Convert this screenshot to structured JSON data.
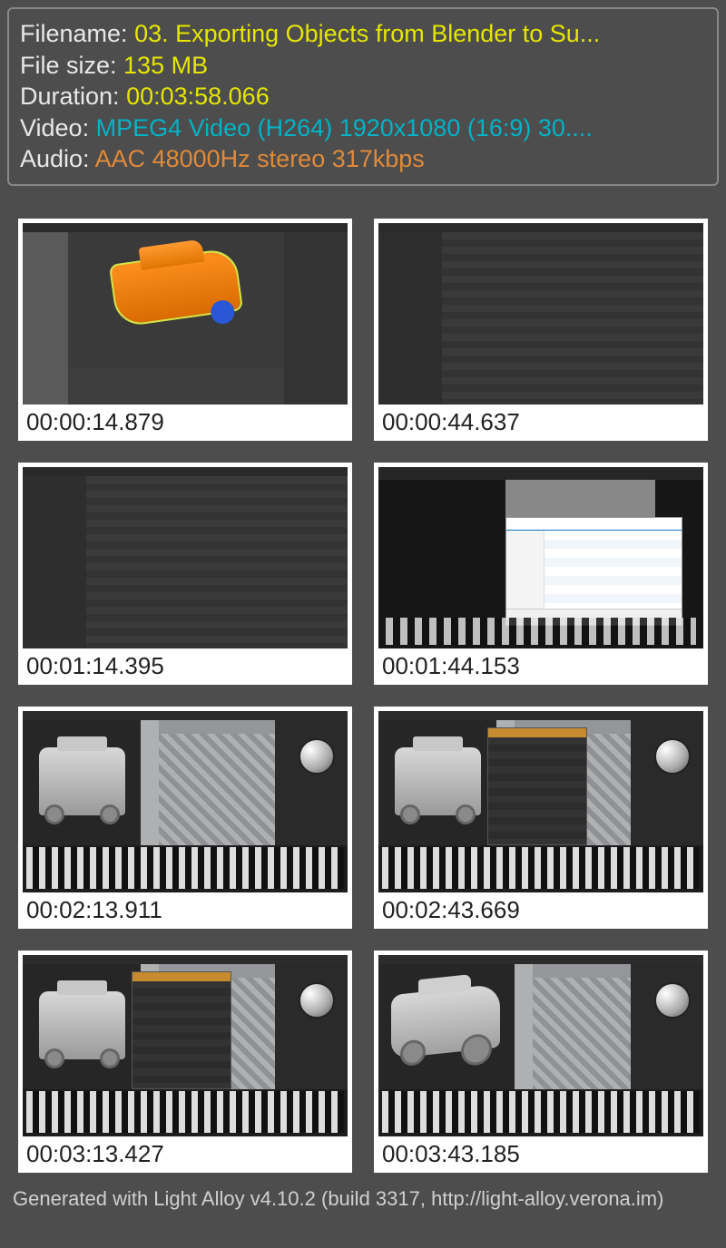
{
  "info": {
    "filename_label": "Filename: ",
    "filename_value": "03. Exporting Objects from Blender to Su...",
    "filesize_label": "File size: ",
    "filesize_value": "135 MB",
    "duration_label": "Duration: ",
    "duration_value": "00:03:58.066",
    "video_label": "Video: ",
    "video_value": "MPEG4 Video (H264) 1920x1080 (16:9) 30....",
    "audio_label": "Audio: ",
    "audio_value": "AAC 48000Hz stereo 317kbps"
  },
  "thumbnails": [
    {
      "ts": "00:00:14.879",
      "type": "blender-car"
    },
    {
      "ts": "00:00:44.637",
      "type": "blender-list"
    },
    {
      "ts": "00:01:14.395",
      "type": "blender-list"
    },
    {
      "ts": "00:01:44.153",
      "type": "file-dialog"
    },
    {
      "ts": "00:02:13.911",
      "type": "sp-front"
    },
    {
      "ts": "00:02:43.669",
      "type": "sp-front-dialog"
    },
    {
      "ts": "00:03:13.427",
      "type": "sp-front-dialog"
    },
    {
      "ts": "00:03:43.185",
      "type": "sp-iso"
    }
  ],
  "footer": "Generated with Light Alloy v4.10.2 (build 3317, http://light-alloy.verona.im)"
}
